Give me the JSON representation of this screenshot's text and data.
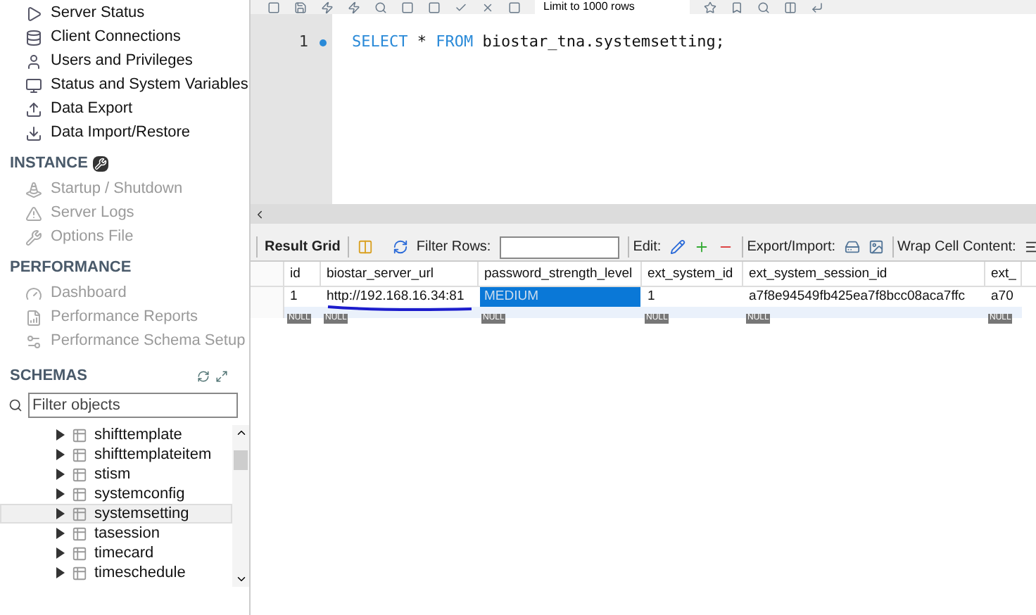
{
  "toolbar": {
    "limit_select": "Limit to 1000 rows"
  },
  "sidebar": {
    "sections": [
      {
        "kind": "untitled",
        "items": [
          {
            "label": "Server Status",
            "disabled": false
          },
          {
            "label": "Client Connections",
            "disabled": false
          },
          {
            "label": "Users and Privileges",
            "disabled": false
          },
          {
            "label": "Status and System Variables",
            "disabled": false
          },
          {
            "label": "Data Export",
            "disabled": false
          },
          {
            "label": "Data Import/Restore",
            "disabled": false
          }
        ]
      },
      {
        "kind": "tools",
        "title": "INSTANCE",
        "items": [
          {
            "label": "Startup / Shutdown",
            "disabled": true
          },
          {
            "label": "Server Logs",
            "disabled": true
          },
          {
            "label": "Options File",
            "disabled": true
          }
        ]
      },
      {
        "kind": "plain",
        "title": "PERFORMANCE",
        "items": [
          {
            "label": "Dashboard",
            "disabled": true
          },
          {
            "label": "Performance Reports",
            "disabled": true
          },
          {
            "label": "Performance Schema Setup",
            "disabled": true
          }
        ]
      }
    ],
    "schemas": {
      "title": "SCHEMAS",
      "filter_placeholder": "Filter objects",
      "tables": [
        {
          "name": "shifttemplate",
          "selected": false
        },
        {
          "name": "shifttemplateitem",
          "selected": false
        },
        {
          "name": "stism",
          "selected": false
        },
        {
          "name": "systemconfig",
          "selected": false
        },
        {
          "name": "systemsetting",
          "selected": true
        },
        {
          "name": "tasession",
          "selected": false
        },
        {
          "name": "timecard",
          "selected": false
        },
        {
          "name": "timeschedule",
          "selected": false
        }
      ]
    }
  },
  "editor": {
    "lines": [
      {
        "number": "1",
        "tokens": [
          {
            "kind": "keyword",
            "text": "SELECT"
          },
          {
            "kind": "plain",
            "text": "*"
          },
          {
            "kind": "keyword",
            "text": "FROM"
          },
          {
            "kind": "plain",
            "text": "biostar_tna.systemsetting;"
          }
        ]
      }
    ]
  },
  "result": {
    "tab": "Result Grid",
    "filter_label": "Filter Rows:",
    "edit_label": "Edit:",
    "export_label": "Export/Import:",
    "wrap_label": "Wrap Cell Content:",
    "columns": [
      "id",
      "biostar_server_url",
      "password_strength_level",
      "ext_system_id",
      "ext_system_session_id",
      "ext_"
    ],
    "rows": [
      {
        "cells": [
          {
            "text": "1",
            "selected": false
          },
          {
            "text": "http://192.168.16.34:81",
            "selected": false,
            "underlined": true
          },
          {
            "text": "MEDIUM",
            "selected": true
          },
          {
            "text": "1",
            "selected": false
          },
          {
            "text": "a7f8e94549fb425ea7f8bcc08aca7ffc",
            "selected": false
          },
          {
            "text": "a70",
            "selected": false
          }
        ]
      }
    ],
    "new_row": [
      "NULL",
      "NULL",
      "NULL",
      "NULL",
      "NULL",
      "NULL"
    ]
  }
}
